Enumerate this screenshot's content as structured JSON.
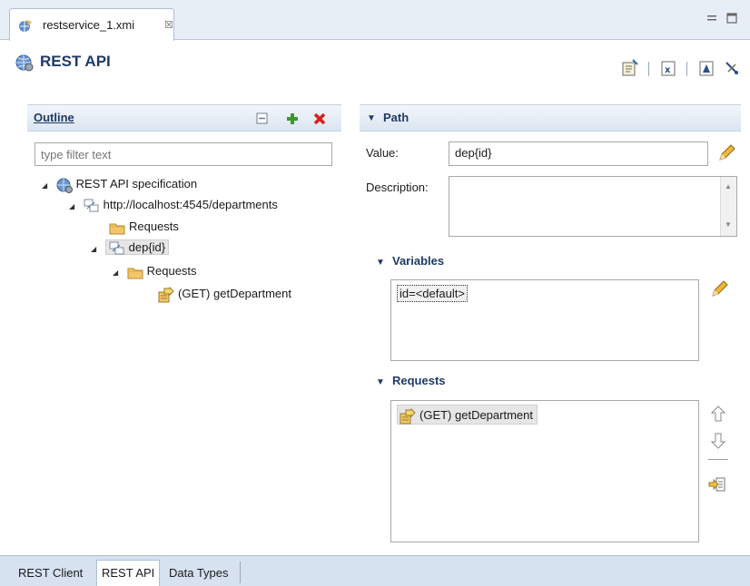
{
  "editor_tab": {
    "title": "restservice_1.xmi",
    "close_glyph": "☒"
  },
  "window_controls": {
    "minimize": "▭",
    "maximize": "□"
  },
  "page": {
    "title": "REST API"
  },
  "outline": {
    "title": "Outline",
    "filter_placeholder": "type filter text",
    "tree": {
      "root": "REST API specification",
      "service": "http://localhost:4545/departments",
      "requests_1": "Requests",
      "path": "dep{id}",
      "requests_2": "Requests",
      "request": "(GET) getDepartment"
    }
  },
  "path_section": {
    "title": "Path",
    "value_label": "Value:",
    "value": "dep{id}",
    "description_label": "Description:",
    "description": ""
  },
  "variables_section": {
    "title": "Variables",
    "items": [
      "id=<default>"
    ]
  },
  "requests_section": {
    "title": "Requests",
    "items": [
      "(GET) getDepartment"
    ]
  },
  "bottom_tabs": [
    "REST Client",
    "REST API",
    "Data Types"
  ],
  "colors": {
    "accent": "#1e3a66",
    "tab_strip": "#e8eef6",
    "delete": "#d81e1e",
    "add": "#3a9a27"
  }
}
